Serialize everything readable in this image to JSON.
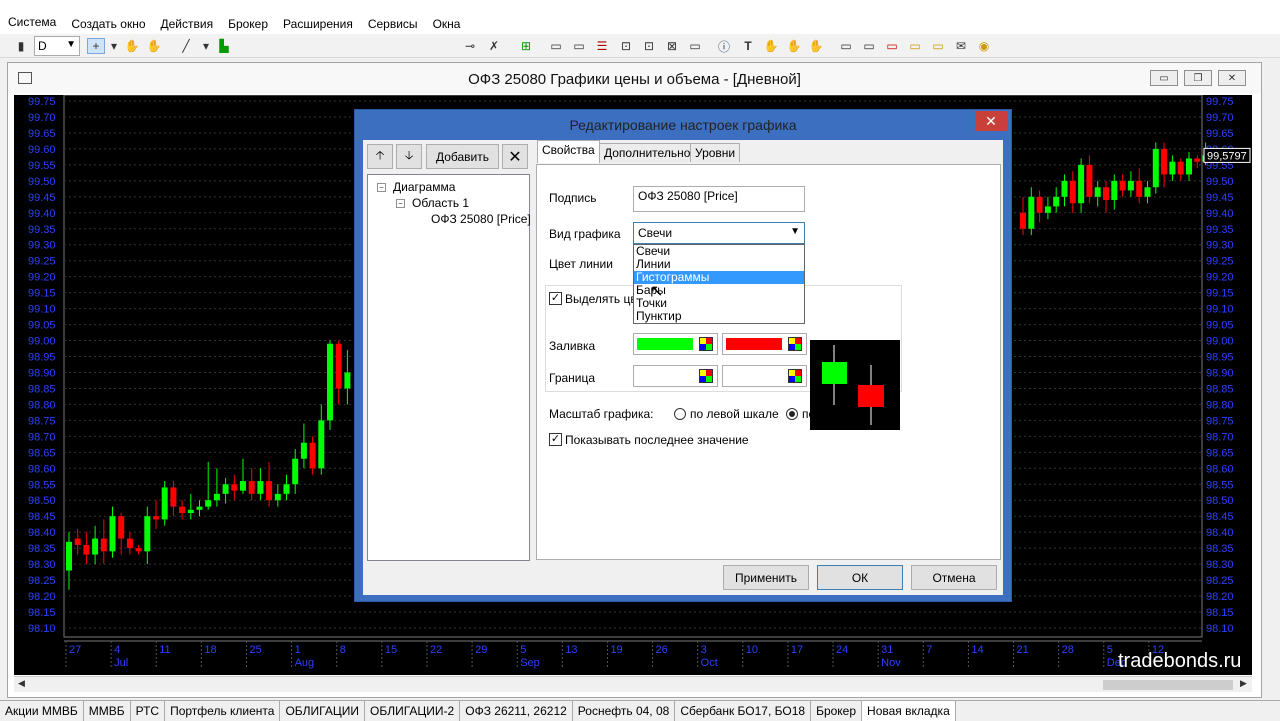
{
  "menu": [
    "Система",
    "Создать окно",
    "Действия",
    "Брокер",
    "Расширения",
    "Сервисы",
    "Окна"
  ],
  "toolbar": {
    "interval": "D",
    "plus": "+"
  },
  "window": {
    "title": "ОФЗ 25080 Графики цены и объема - [Дневной]",
    "min": "▭",
    "restore": "❐",
    "close": "✕"
  },
  "chart_data": {
    "type": "candlestick",
    "title": "",
    "y_ticks": [
      "99.75",
      "99.70",
      "99.65",
      "99.60",
      "99.55",
      "99.50",
      "99.45",
      "99.40",
      "99.35",
      "99.30",
      "99.25",
      "99.20",
      "99.15",
      "99.10",
      "99.05",
      "99.00",
      "98.95",
      "98.90",
      "98.85",
      "98.80",
      "98.75",
      "98.70",
      "98.65",
      "98.60",
      "98.55",
      "98.50",
      "98.45",
      "98.40",
      "98.35",
      "98.30",
      "98.25",
      "98.20",
      "98.15",
      "98.10"
    ],
    "ylim": [
      98.1,
      99.75
    ],
    "last_value": "99,5797",
    "x_days": [
      "27",
      "4",
      "11",
      "18",
      "25",
      "1",
      "8",
      "15",
      "22",
      "29",
      "5",
      "13",
      "19",
      "26",
      "3",
      "10",
      "17",
      "24",
      "31",
      "7",
      "14",
      "21",
      "28",
      "5",
      "12"
    ],
    "x_months": [
      "Jul",
      "Aug",
      "Sep",
      "Oct",
      "Nov",
      "Dec"
    ],
    "up_color": "#00ff00",
    "down_color": "#ff0000",
    "candles_left": [
      [
        98.28,
        98.37,
        98.22,
        98.4
      ],
      [
        98.38,
        98.36,
        98.33,
        98.41
      ],
      [
        98.36,
        98.33,
        98.3,
        98.4
      ],
      [
        98.33,
        98.38,
        98.3,
        98.42
      ],
      [
        98.38,
        98.34,
        98.3,
        98.44
      ],
      [
        98.34,
        98.45,
        98.32,
        98.48
      ],
      [
        98.45,
        98.38,
        98.33,
        98.46
      ],
      [
        98.38,
        98.35,
        98.33,
        98.4
      ],
      [
        98.35,
        98.34,
        98.33,
        98.36
      ],
      [
        98.34,
        98.45,
        98.3,
        98.48
      ],
      [
        98.45,
        98.44,
        98.41,
        98.5
      ],
      [
        98.44,
        98.54,
        98.42,
        98.56
      ],
      [
        98.54,
        98.48,
        98.45,
        98.56
      ],
      [
        98.48,
        98.46,
        98.44,
        98.5
      ],
      [
        98.46,
        98.47,
        98.44,
        98.52
      ],
      [
        98.47,
        98.48,
        98.45,
        98.5
      ],
      [
        98.48,
        98.5,
        98.47,
        98.62
      ],
      [
        98.5,
        98.52,
        98.48,
        98.6
      ],
      [
        98.52,
        98.55,
        98.49,
        98.57
      ],
      [
        98.55,
        98.53,
        98.5,
        98.58
      ],
      [
        98.53,
        98.56,
        98.52,
        98.63
      ],
      [
        98.56,
        98.52,
        98.5,
        98.6
      ],
      [
        98.52,
        98.56,
        98.5,
        98.6
      ],
      [
        98.56,
        98.5,
        98.48,
        98.62
      ],
      [
        98.5,
        98.52,
        98.48,
        98.55
      ],
      [
        98.52,
        98.55,
        98.5,
        98.58
      ],
      [
        98.55,
        98.63,
        98.52,
        98.66
      ],
      [
        98.63,
        98.68,
        98.6,
        98.74
      ],
      [
        98.68,
        98.6,
        98.58,
        98.7
      ],
      [
        98.6,
        98.75,
        98.58,
        98.8
      ],
      [
        98.75,
        98.99,
        98.72,
        99.0
      ],
      [
        98.99,
        98.85,
        98.8,
        99.0
      ],
      [
        98.85,
        98.9,
        98.8,
        98.97
      ]
    ],
    "candles_right": [
      [
        99.4,
        99.35,
        99.33,
        99.45
      ],
      [
        99.35,
        99.45,
        99.33,
        99.48
      ],
      [
        99.45,
        99.4,
        99.37,
        99.47
      ],
      [
        99.4,
        99.42,
        99.38,
        99.45
      ],
      [
        99.42,
        99.45,
        99.4,
        99.48
      ],
      [
        99.45,
        99.5,
        99.42,
        99.52
      ],
      [
        99.5,
        99.43,
        99.4,
        99.53
      ],
      [
        99.43,
        99.55,
        99.4,
        99.57
      ],
      [
        99.55,
        99.45,
        99.43,
        99.58
      ],
      [
        99.45,
        99.48,
        99.42,
        99.5
      ],
      [
        99.48,
        99.44,
        99.4,
        99.5
      ],
      [
        99.44,
        99.5,
        99.41,
        99.52
      ],
      [
        99.5,
        99.47,
        99.45,
        99.52
      ],
      [
        99.47,
        99.5,
        99.45,
        99.53
      ],
      [
        99.5,
        99.45,
        99.43,
        99.54
      ],
      [
        99.45,
        99.48,
        99.43,
        99.5
      ],
      [
        99.48,
        99.6,
        99.46,
        99.62
      ],
      [
        99.6,
        99.52,
        99.48,
        99.62
      ],
      [
        99.52,
        99.56,
        99.5,
        99.58
      ],
      [
        99.56,
        99.52,
        99.5,
        99.57
      ],
      [
        99.52,
        99.57,
        99.5,
        99.59
      ],
      [
        99.57,
        99.56,
        99.54,
        99.58
      ],
      [
        99.56,
        99.58,
        99.55,
        99.62
      ]
    ]
  },
  "watermark": "tradebonds.ru",
  "tabs": [
    "Акции ММВБ",
    "ММВБ",
    "РТС",
    "Портфель клиента",
    "ОБЛИГАЦИИ",
    "ОБЛИГАЦИИ-2",
    "ОФЗ 26211, 26212",
    "Роснефть 04, 08",
    "Сбербанк БО17, БО18",
    "Брокер",
    "Новая вкладка"
  ],
  "active_tab": "Новая вкладка",
  "dialog": {
    "title": "Редактирование настроек графика",
    "close": "✕",
    "up": "🡡",
    "down": "🡣",
    "add": "Добавить",
    "remove": "✕",
    "tree": {
      "root": "Диаграмма",
      "area": "Область 1",
      "series": "ОФЗ 25080 [Price]"
    },
    "tabs": [
      "Свойства",
      "Дополнительно",
      "Уровни"
    ],
    "caption_label": "Подпись",
    "caption_value": "ОФЗ 25080 [Price]",
    "type_label": "Вид графика",
    "type_value": "Свечи",
    "type_options": [
      "Свечи",
      "Линии",
      "Гистограммы",
      "Бары",
      "Точки",
      "Пунктир"
    ],
    "type_selected": "Гистограммы",
    "line_color_label": "Цвет линии",
    "highlight_label": "Выделять цве",
    "fill_label": "Заливка",
    "border_label": "Граница",
    "fill_up": "#00ff00",
    "fill_down": "#ff0000",
    "scale_label": "Масштаб графика:",
    "scale_left": "по левой шкале",
    "scale_right": "по правой шкале",
    "show_last": "Показывать последнее значение",
    "apply": "Применить",
    "ok": "ОК",
    "cancel": "Отмена"
  }
}
